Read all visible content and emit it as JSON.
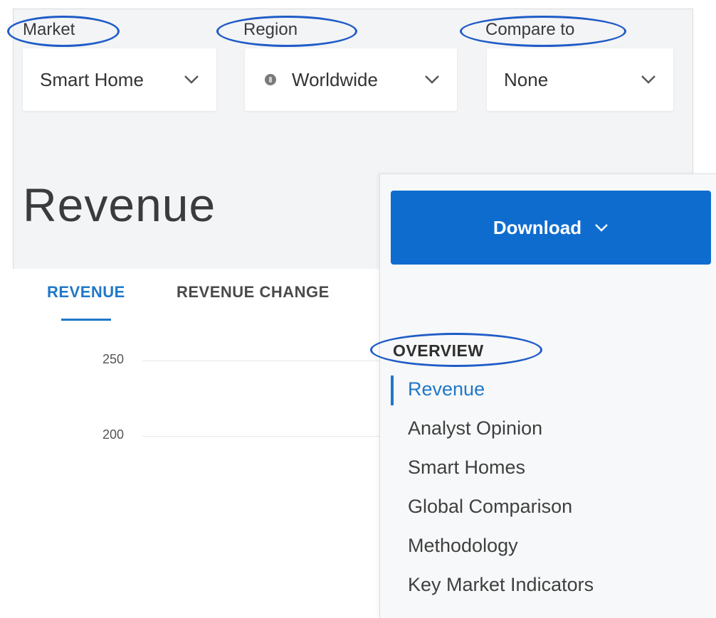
{
  "filters": {
    "market": {
      "label": "Market",
      "value": "Smart Home"
    },
    "region": {
      "label": "Region",
      "value": "Worldwide",
      "icon": "globe-icon"
    },
    "compare": {
      "label": "Compare to",
      "value": "None"
    }
  },
  "page_title": "Revenue",
  "chart": {
    "tabs": [
      {
        "label": "REVENUE",
        "active": true
      },
      {
        "label": "REVENUE CHANGE",
        "active": false
      }
    ],
    "y_ticks": [
      "250",
      "200"
    ]
  },
  "sidebar": {
    "download_label": "Download",
    "section_heading": "OVERVIEW",
    "nav_items": [
      {
        "label": "Revenue",
        "active": true
      },
      {
        "label": "Analyst Opinion",
        "active": false
      },
      {
        "label": "Smart Homes",
        "active": false
      },
      {
        "label": "Global Comparison",
        "active": false
      },
      {
        "label": "Methodology",
        "active": false
      },
      {
        "label": "Key Market Indicators",
        "active": false
      }
    ]
  },
  "colors": {
    "accent": "#1f78c8",
    "button": "#0f6ccf",
    "annotation": "#1f5cc7"
  }
}
